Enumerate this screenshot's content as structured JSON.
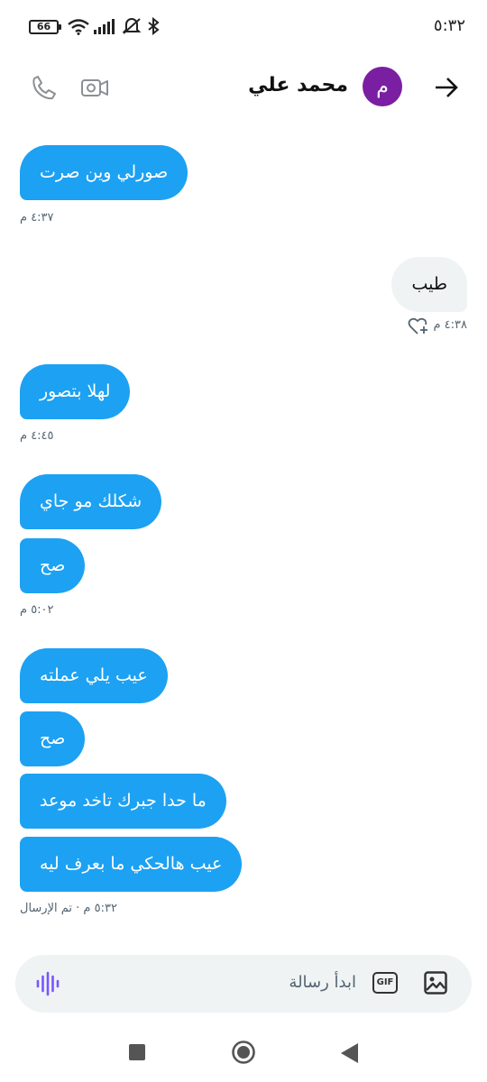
{
  "status_bar": {
    "battery": "66",
    "time": "٥:٣٢",
    "icons": [
      "wifi-icon",
      "signal-icon",
      "vibrate-off-icon",
      "bluetooth-icon"
    ]
  },
  "header": {
    "contact_name": "محمد علي",
    "avatar_letter": "م",
    "avatar_color": "#7b1fa2",
    "icons": [
      "back-arrow-icon",
      "video-call-icon",
      "phone-call-icon"
    ]
  },
  "messages": [
    {
      "side": "received",
      "text": "صورلي وين صرت",
      "time": "٤:٣٧ م"
    },
    {
      "side": "sent",
      "text": "طيب",
      "time": "٤:٣٨ م"
    },
    {
      "side": "received",
      "text": "لهلا بتصور",
      "time": "٤:٤٥ م"
    },
    {
      "side": "received",
      "text": "شكلك مو جاي"
    },
    {
      "side": "received",
      "text": "صح",
      "time": "٥:٠٢ م"
    },
    {
      "side": "received",
      "text": "عيب يلي عملته"
    },
    {
      "side": "received",
      "text": "صح"
    },
    {
      "side": "received",
      "text": "ما حدا جبرك تاخد موعد"
    },
    {
      "side": "received",
      "text": "عيب هالحكي ما بعرف ليه",
      "time": "٥:٣٢ م · تم الإرسال"
    }
  ],
  "composer": {
    "placeholder": "ابدأ رسالة",
    "gif_label": "GIF",
    "icons": [
      "image-icon",
      "gif-icon",
      "voice-icon"
    ]
  },
  "nav_bar": {
    "icons": [
      "recents-icon",
      "home-icon",
      "back-icon"
    ]
  },
  "colors": {
    "received_bubble": "#1da1f2",
    "sent_bubble": "#eff3f4",
    "accent_voice": "#7856ff"
  }
}
